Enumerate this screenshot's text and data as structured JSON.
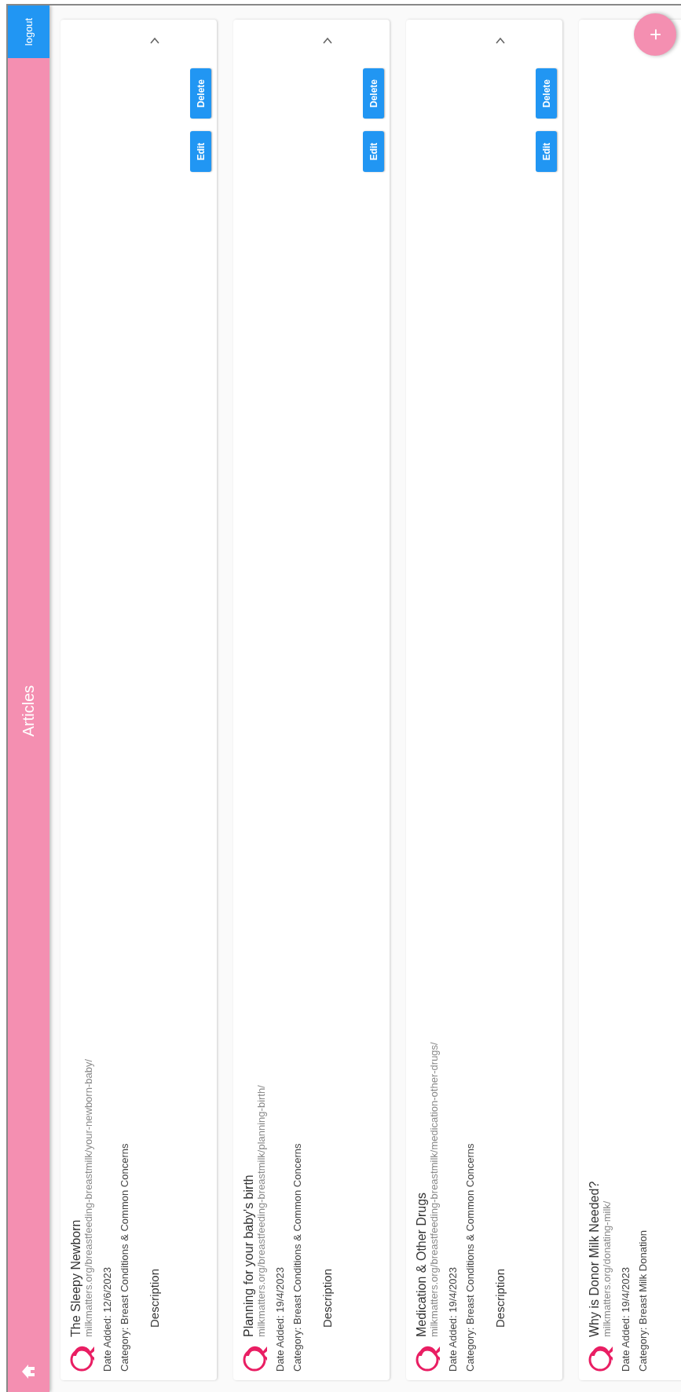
{
  "header": {
    "title": "Articles",
    "logout_label": "logout"
  },
  "articles": [
    {
      "title": "The Sleepy Newborn",
      "url": "milkmatters.org/breastfeeding-breastmilk/your-newborn-baby/",
      "date_added": "Date Added: 12/6/2023",
      "category": "Category: Breast Conditions & Common Concerns",
      "description_label": "Description",
      "actions": [
        "Edit",
        "Delete"
      ]
    },
    {
      "title": "Planning for your baby's birth",
      "url": "milkmatters.org/breastfeeding-breastmilk/planning-birth/",
      "date_added": "Date Added: 19/4/2023",
      "category": "Category: Breast Conditions & Common Concerns",
      "description_label": "Description",
      "actions": [
        "Edit",
        "Delete"
      ]
    },
    {
      "title": "Medication & Other Drugs",
      "url": "milkmatters.org/breastfeeding-breastmilk/medication-other-drugs/",
      "date_added": "Date Added: 19/4/2023",
      "category": "Category: Breast Conditions & Common Concerns",
      "description_label": "Description",
      "actions": [
        "Edit",
        "Delete"
      ]
    },
    {
      "title": "Why is Donor Milk Needed?",
      "url": "milkmatters.org/donating-milk/",
      "date_added": "Date Added: 19/4/2023",
      "category": "Category: Breast Milk Donation"
    }
  ],
  "add_button": "+"
}
